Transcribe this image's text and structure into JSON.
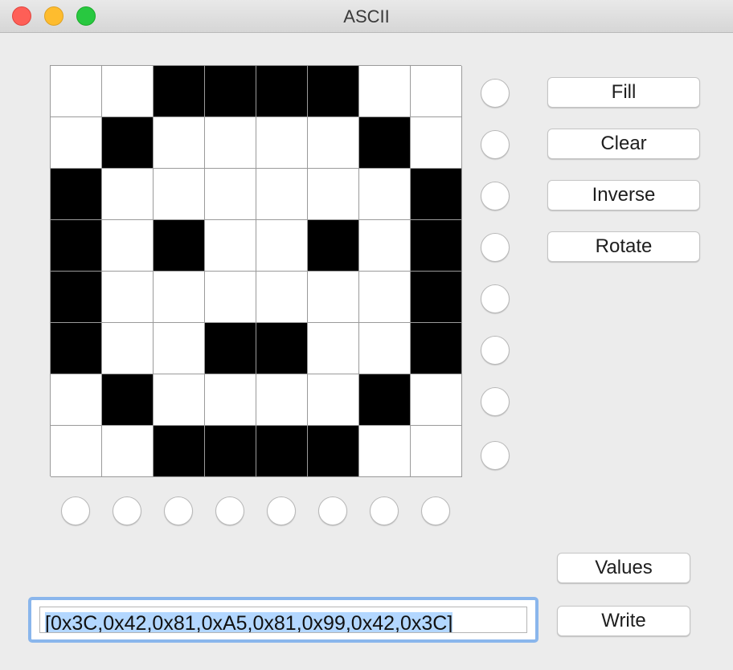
{
  "window": {
    "title": "ASCII"
  },
  "grid_rows": [
    [
      0,
      0,
      1,
      1,
      1,
      1,
      0,
      0
    ],
    [
      0,
      1,
      0,
      0,
      0,
      0,
      1,
      0
    ],
    [
      1,
      0,
      0,
      0,
      0,
      0,
      0,
      1
    ],
    [
      1,
      0,
      1,
      0,
      0,
      1,
      0,
      1
    ],
    [
      1,
      0,
      0,
      0,
      0,
      0,
      0,
      1
    ],
    [
      1,
      0,
      0,
      1,
      1,
      0,
      0,
      1
    ],
    [
      0,
      1,
      0,
      0,
      0,
      0,
      1,
      0
    ],
    [
      0,
      0,
      1,
      1,
      1,
      1,
      0,
      0
    ]
  ],
  "buttons": {
    "fill": "Fill",
    "clear": "Clear",
    "inverse": "Inverse",
    "rotate": "Rotate",
    "values": "Values",
    "write": "Write"
  },
  "output": {
    "value": "[0x3C,0x42,0x81,0xA5,0x81,0x99,0x42,0x3C]"
  },
  "colors": {
    "on": "#000000",
    "off": "#ffffff",
    "focus_ring": "#8ab6ec",
    "selection": "#b3d7ff"
  }
}
